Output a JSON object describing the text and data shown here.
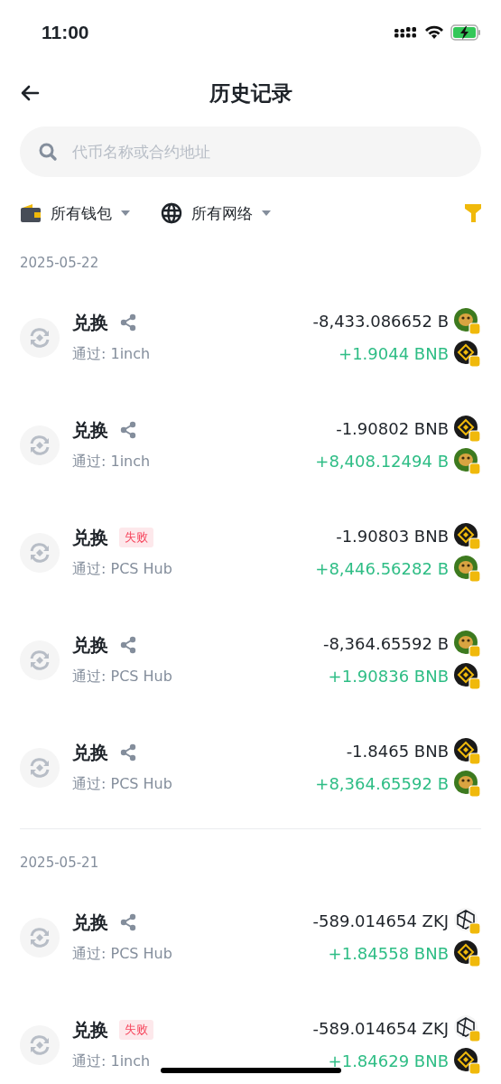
{
  "status_bar": {
    "time": "11:00"
  },
  "header": {
    "title": "历史记录"
  },
  "search": {
    "placeholder": "代币名称或合约地址"
  },
  "filters": [
    {
      "kind": "wallet",
      "label": "所有钱包"
    },
    {
      "kind": "network",
      "label": "所有网络"
    }
  ],
  "groups": [
    {
      "date": "2025-05-22",
      "transactions": [
        {
          "title": "兑换",
          "failed": false,
          "via": "通过: 1inch",
          "amounts": [
            {
              "text": "-8,433.086652 B",
              "positive": false,
              "kind": "cake"
            },
            {
              "text": "+1.9044 BNB",
              "positive": true,
              "kind": "bnb"
            }
          ]
        },
        {
          "title": "兑换",
          "failed": false,
          "via": "通过: 1inch",
          "amounts": [
            {
              "text": "-1.90802 BNB",
              "positive": false,
              "kind": "bnb"
            },
            {
              "text": "+8,408.12494 B",
              "positive": true,
              "kind": "cake"
            }
          ]
        },
        {
          "title": "兑换",
          "failed": true,
          "status": "失败",
          "via": "通过: PCS Hub",
          "amounts": [
            {
              "text": "-1.90803 BNB",
              "positive": false,
              "kind": "bnb"
            },
            {
              "text": "+8,446.56282 B",
              "positive": true,
              "kind": "cake"
            }
          ]
        },
        {
          "title": "兑换",
          "failed": false,
          "via": "通过: PCS Hub",
          "amounts": [
            {
              "text": "-8,364.65592 B",
              "positive": false,
              "kind": "cake"
            },
            {
              "text": "+1.90836 BNB",
              "positive": true,
              "kind": "bnb"
            }
          ]
        },
        {
          "title": "兑换",
          "failed": false,
          "via": "通过: PCS Hub",
          "amounts": [
            {
              "text": "-1.8465 BNB",
              "positive": false,
              "kind": "bnb"
            },
            {
              "text": "+8,364.65592 B",
              "positive": true,
              "kind": "cake"
            }
          ]
        }
      ]
    },
    {
      "date": "2025-05-21",
      "transactions": [
        {
          "title": "兑换",
          "failed": false,
          "via": "通过: PCS Hub",
          "amounts": [
            {
              "text": "-589.014654 ZKJ",
              "positive": false,
              "kind": "zkj"
            },
            {
              "text": "+1.84558 BNB",
              "positive": true,
              "kind": "bnb"
            }
          ]
        },
        {
          "title": "兑换",
          "failed": true,
          "status": "失败",
          "via": "通过: 1inch",
          "amounts": [
            {
              "text": "-589.014654 ZKJ",
              "positive": false,
              "kind": "zkj"
            },
            {
              "text": "+1.84629 BNB",
              "positive": true,
              "kind": "bnb"
            }
          ]
        }
      ]
    }
  ]
}
